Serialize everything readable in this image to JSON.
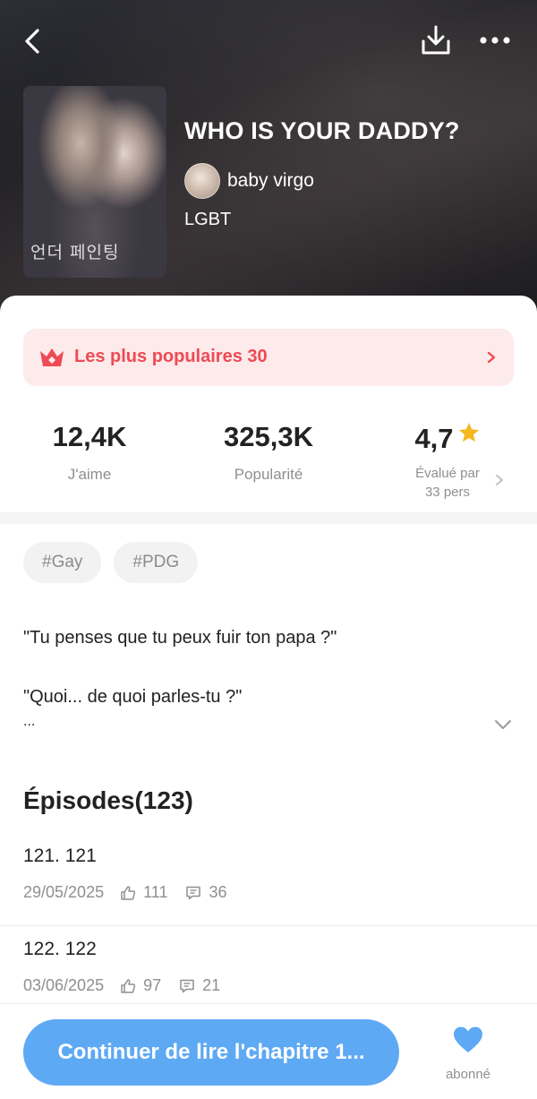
{
  "header": {
    "icons": {
      "back": "chevron-left-icon",
      "download": "download-icon",
      "more": "more-horizontal-icon"
    }
  },
  "comic": {
    "cover_text": "언더 페인팅",
    "title": "WHO IS YOUR DADDY?",
    "author": "baby virgo",
    "genre": "LGBT"
  },
  "ranking": {
    "label": "Les plus populaires 30",
    "icon": "crown-icon",
    "color": "#ee4a55"
  },
  "stats": {
    "likes": {
      "value": "12,4K",
      "label": "J'aime"
    },
    "popularity": {
      "value": "325,3K",
      "label": "Popularité"
    },
    "rating": {
      "value": "4,7",
      "label_line1": "Évalué par",
      "label_line2": "33 pers"
    }
  },
  "tags": [
    "#Gay",
    "#PDG"
  ],
  "synopsis": {
    "line1": "\"Tu penses que tu peux fuir ton papa ?\"",
    "line2": "\"Quoi... de quoi parles-tu ?\"",
    "line3": "..."
  },
  "episodes": {
    "heading": "Épisodes(123)",
    "items": [
      {
        "name": "121. 121",
        "date": "29/05/2025",
        "likes": "111",
        "comments": "36"
      },
      {
        "name": "122. 122",
        "date": "03/06/2025",
        "likes": "97",
        "comments": "21"
      }
    ]
  },
  "footer": {
    "continue_label": "Continuer de lire l'chapitre 1...",
    "follow_label": "abonné",
    "accent": "#5ea9f4"
  }
}
